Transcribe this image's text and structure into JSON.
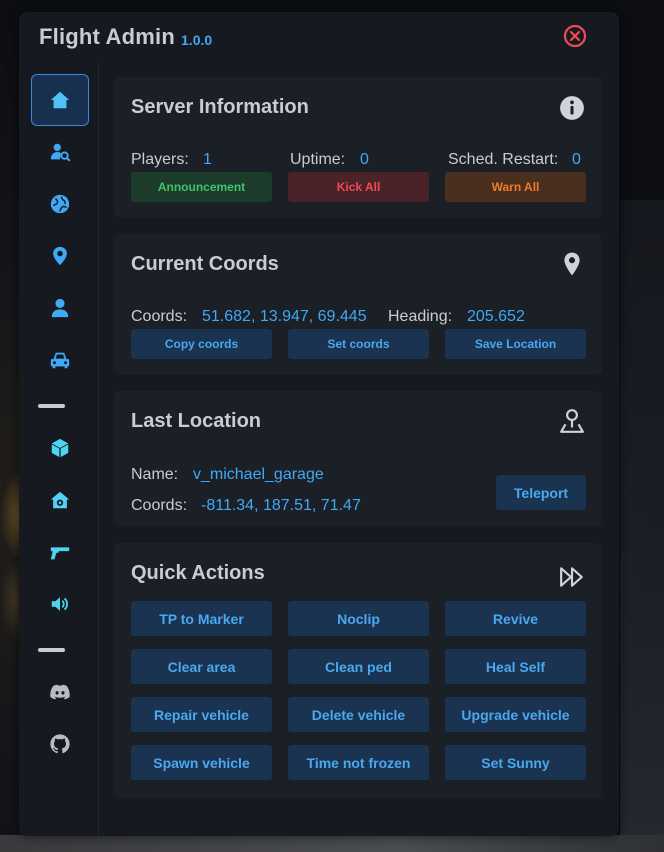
{
  "app": {
    "title": "Flight Admin",
    "version": "1.0.0"
  },
  "sidebar": {
    "items": [
      {
        "icon": "home-icon",
        "active": true
      },
      {
        "icon": "player-search-icon"
      },
      {
        "icon": "globe-icon"
      },
      {
        "icon": "map-pin-icon"
      },
      {
        "icon": "user-icon"
      },
      {
        "icon": "car-icon"
      },
      {
        "icon": "cube-icon"
      },
      {
        "icon": "house-gear-icon"
      },
      {
        "icon": "gun-icon"
      },
      {
        "icon": "speaker-icon"
      },
      {
        "icon": "discord-icon"
      },
      {
        "icon": "github-icon"
      }
    ]
  },
  "server_info": {
    "title": "Server Information",
    "players_label": "Players:",
    "players_value": "1",
    "uptime_label": "Uptime:",
    "uptime_value": "0",
    "restart_label": "Sched. Restart:",
    "restart_value": "0",
    "buttons": {
      "announcement": "Announcement",
      "kick_all": "Kick All",
      "warn_all": "Warn All"
    }
  },
  "current_coords": {
    "title": "Current Coords",
    "coords_label": "Coords:",
    "coords_value": "51.682, 13.947, 69.445",
    "heading_label": "Heading:",
    "heading_value": "205.652",
    "buttons": {
      "copy": "Copy coords",
      "set": "Set coords",
      "save": "Save Location"
    }
  },
  "last_location": {
    "title": "Last Location",
    "name_label": "Name:",
    "name_value": "v_michael_garage",
    "coords_label": "Coords:",
    "coords_value": "-811.34, 187.51, 71.47",
    "teleport": "Teleport"
  },
  "quick_actions": {
    "title": "Quick Actions",
    "buttons": [
      "TP to Marker",
      "Noclip",
      "Revive",
      "Clear area",
      "Clean ped",
      "Heal Self",
      "Repair vehicle",
      "Delete vehicle",
      "Upgrade vehicle",
      "Spawn vehicle",
      "Time not frozen",
      "Set Sunny"
    ]
  },
  "colors": {
    "accent": "#3fa9f5",
    "card_bg": "#1b1f26",
    "window_bg": "#16191f",
    "close": "#ef4b55",
    "green": "#3fc46a",
    "red": "#ef4b55",
    "orange": "#f17a2c"
  }
}
